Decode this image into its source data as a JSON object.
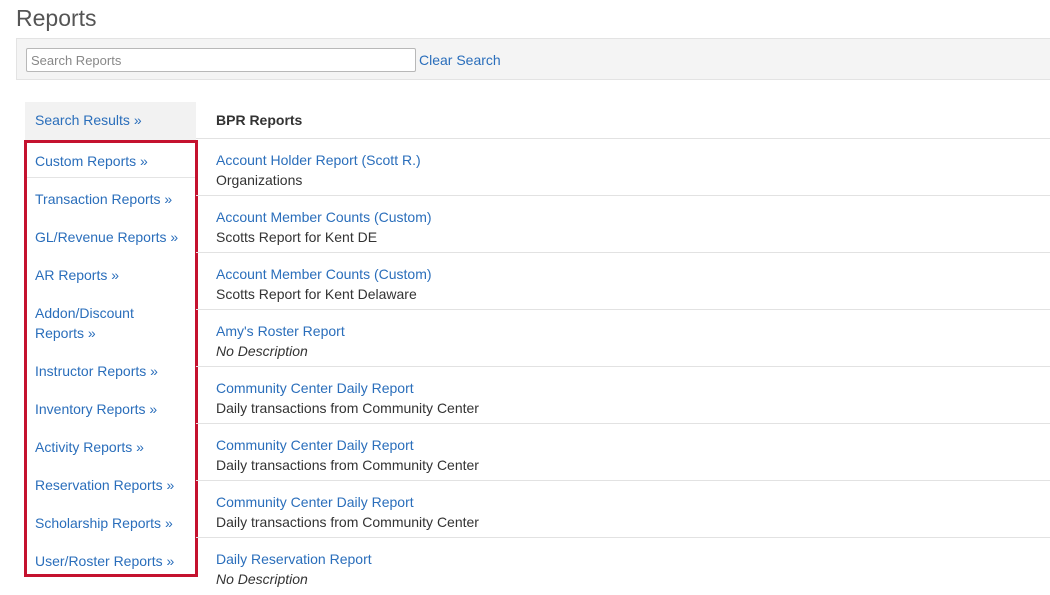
{
  "page": {
    "title": "Reports"
  },
  "search": {
    "placeholder": "Search Reports",
    "value": "",
    "clear_label": "Clear Search"
  },
  "sidebar": {
    "top_item": "Search Results »",
    "items": [
      {
        "label": "Custom Reports »"
      },
      {
        "label": "Transaction Reports »"
      },
      {
        "label": "GL/Revenue Reports »"
      },
      {
        "label": "AR Reports »"
      },
      {
        "label": "Addon/Discount Reports »"
      },
      {
        "label": "Instructor Reports »"
      },
      {
        "label": "Inventory Reports »"
      },
      {
        "label": "Activity Reports »"
      },
      {
        "label": "Reservation Reports »"
      },
      {
        "label": "Scholarship Reports »"
      },
      {
        "label": "User/Roster Reports »"
      }
    ]
  },
  "main": {
    "section_title": "BPR Reports",
    "reports": [
      {
        "title": "Account Holder Report (Scott R.)",
        "description": "Organizations"
      },
      {
        "title": "Account Member Counts (Custom)",
        "description": "Scotts Report for Kent DE"
      },
      {
        "title": "Account Member Counts (Custom)",
        "description": "Scotts Report for Kent Delaware"
      },
      {
        "title": "Amy's Roster Report",
        "description": "No Description"
      },
      {
        "title": "Community Center Daily Report",
        "description": "Daily transactions from Community Center"
      },
      {
        "title": "Community Center Daily Report",
        "description": "Daily transactions from Community Center"
      },
      {
        "title": "Community Center Daily Report",
        "description": "Daily transactions from Community Center"
      },
      {
        "title": "Daily Reservation Report",
        "description": "No Description"
      }
    ]
  }
}
